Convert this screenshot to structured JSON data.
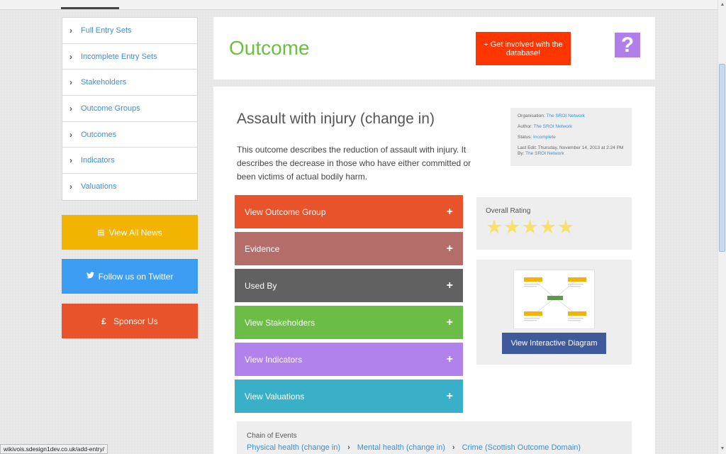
{
  "sidebar": {
    "items": [
      {
        "label": "Full Entry Sets"
      },
      {
        "label": "Incomplete Entry Sets"
      },
      {
        "label": "Stakeholders"
      },
      {
        "label": "Outcome Groups"
      },
      {
        "label": "Outcomes"
      },
      {
        "label": "Indicators"
      },
      {
        "label": "Valuations"
      }
    ],
    "news_label": "View All News",
    "twitter_label": "Follow us on Twitter",
    "sponsor_label": "Sponsor Us",
    "sponsor_symbol": "£"
  },
  "header": {
    "title": "Outcome",
    "get_involved_label": "+ Get involved with the database!",
    "help_symbol": "?"
  },
  "outcome": {
    "title": "Assault with injury (change in)",
    "description": "This outcome describes the reduction of assault with injury. It describes the decrease in those who have either committed or been victims of actual bodily harm."
  },
  "meta": {
    "organisation_label": "Organisation:",
    "organisation": "The SROI Network",
    "author_label": "Author:",
    "author": "The SROI Network",
    "status_label": "Status:",
    "status": "Incomplete",
    "last_edit_label": "Last Edit: Thursday, November 14, 2013 at 2:24 PM By:",
    "last_edit_by": "The SROI Network"
  },
  "accordion": [
    {
      "label": "View Outcome Group",
      "color": "#e9532b"
    },
    {
      "label": "Evidence",
      "color": "#b56d69"
    },
    {
      "label": "Used By",
      "color": "#616161"
    },
    {
      "label": "View Stakeholders",
      "color": "#6cbd48"
    },
    {
      "label": "View Indicators",
      "color": "#b282ec"
    },
    {
      "label": "View Valuations",
      "color": "#39b0c8"
    }
  ],
  "rating": {
    "label": "Overall Rating",
    "stars": 5,
    "max_stars": 5
  },
  "diagram": {
    "button_label": "View Interactive Diagram"
  },
  "chain": {
    "label": "Chain of Events",
    "links": [
      "Physical health (change in)",
      "Mental health (change in)",
      "Crime (Scottish Outcome Domain)"
    ]
  },
  "status_bar": {
    "url": "wikivois.sdesign1dev.co.uk/add-entry/"
  }
}
